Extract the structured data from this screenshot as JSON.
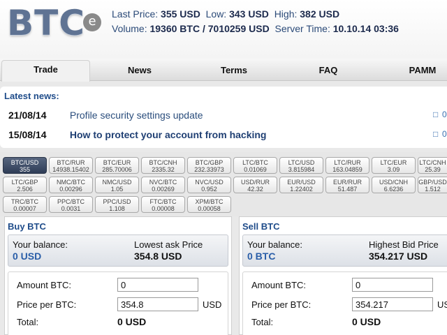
{
  "header": {
    "logo_text": "BTC",
    "logo_badge": "e",
    "last_price_label": "Last Price:",
    "last_price": "355 USD",
    "low_label": "Low:",
    "low": "343 USD",
    "high_label": "High:",
    "high": "382 USD",
    "volume_label": "Volume:",
    "volume": "19360 BTC / 7010259 USD",
    "server_time_label": "Server Time:",
    "server_time": "10.10.14 03:36"
  },
  "nav": {
    "tabs": [
      {
        "label": "Trade"
      },
      {
        "label": "News"
      },
      {
        "label": "Terms"
      },
      {
        "label": "FAQ"
      },
      {
        "label": "PAMM"
      }
    ]
  },
  "news": {
    "heading": "Latest news:",
    "items": [
      {
        "date": "21/08/14",
        "title": "Profile security settings update",
        "comments": "0"
      },
      {
        "date": "15/08/14",
        "title": "How to protect your account from hacking",
        "comments": "0"
      }
    ]
  },
  "pairs": [
    {
      "name": "BTC/USD",
      "value": "355"
    },
    {
      "name": "BTC/RUR",
      "value": "14938.15402"
    },
    {
      "name": "BTC/EUR",
      "value": "285.70006"
    },
    {
      "name": "BTC/CNH",
      "value": "2335.32"
    },
    {
      "name": "BTC/GBP",
      "value": "232.33973"
    },
    {
      "name": "LTC/BTC",
      "value": "0.01069"
    },
    {
      "name": "LTC/USD",
      "value": "3.815984"
    },
    {
      "name": "LTC/RUR",
      "value": "163.04859"
    },
    {
      "name": "LTC/EUR",
      "value": "3.09"
    },
    {
      "name": "LTC/CNH",
      "value": "25.39"
    },
    {
      "name": "LTC/GBP",
      "value": "2.506"
    },
    {
      "name": "NMC/BTC",
      "value": "0.00296"
    },
    {
      "name": "NMC/USD",
      "value": "1.05"
    },
    {
      "name": "NVC/BTC",
      "value": "0.00269"
    },
    {
      "name": "NVC/USD",
      "value": "0.952"
    },
    {
      "name": "USD/RUR",
      "value": "42.32"
    },
    {
      "name": "EUR/USD",
      "value": "1.22402"
    },
    {
      "name": "EUR/RUR",
      "value": "51.487"
    },
    {
      "name": "USD/CNH",
      "value": "6.6236"
    },
    {
      "name": "GBP/USD",
      "value": "1.512"
    },
    {
      "name": "TRC/BTC",
      "value": "0.00007"
    },
    {
      "name": "PPC/BTC",
      "value": "0.0031"
    },
    {
      "name": "PPC/USD",
      "value": "1.108"
    },
    {
      "name": "FTC/BTC",
      "value": "0.00008"
    },
    {
      "name": "XPM/BTC",
      "value": "0.00058"
    }
  ],
  "buy": {
    "title": "Buy BTC",
    "balance_label": "Your balance:",
    "balance": "0 USD",
    "price_label": "Lowest ask Price",
    "price": "354.8 USD",
    "amount_label": "Amount BTC:",
    "amount_value": "0",
    "price_per_label": "Price per BTC:",
    "price_per_value": "354.8",
    "price_unit": "USD",
    "total_label": "Total:",
    "total": "0 USD"
  },
  "sell": {
    "title": "Sell BTC",
    "balance_label": "Your balance:",
    "balance": "0 BTC",
    "price_label": "Highest Bid Price",
    "price": "354.217 USD",
    "amount_label": "Amount BTC:",
    "amount_value": "0",
    "price_per_label": "Price per BTC:",
    "price_per_value": "354.217",
    "price_unit": "USD",
    "total_label": "Total:",
    "total": "0 USD"
  },
  "colors": {
    "accent": "#1f4c8a",
    "active_pair": "#3a4860",
    "balance_value": "#2a5ea8"
  }
}
